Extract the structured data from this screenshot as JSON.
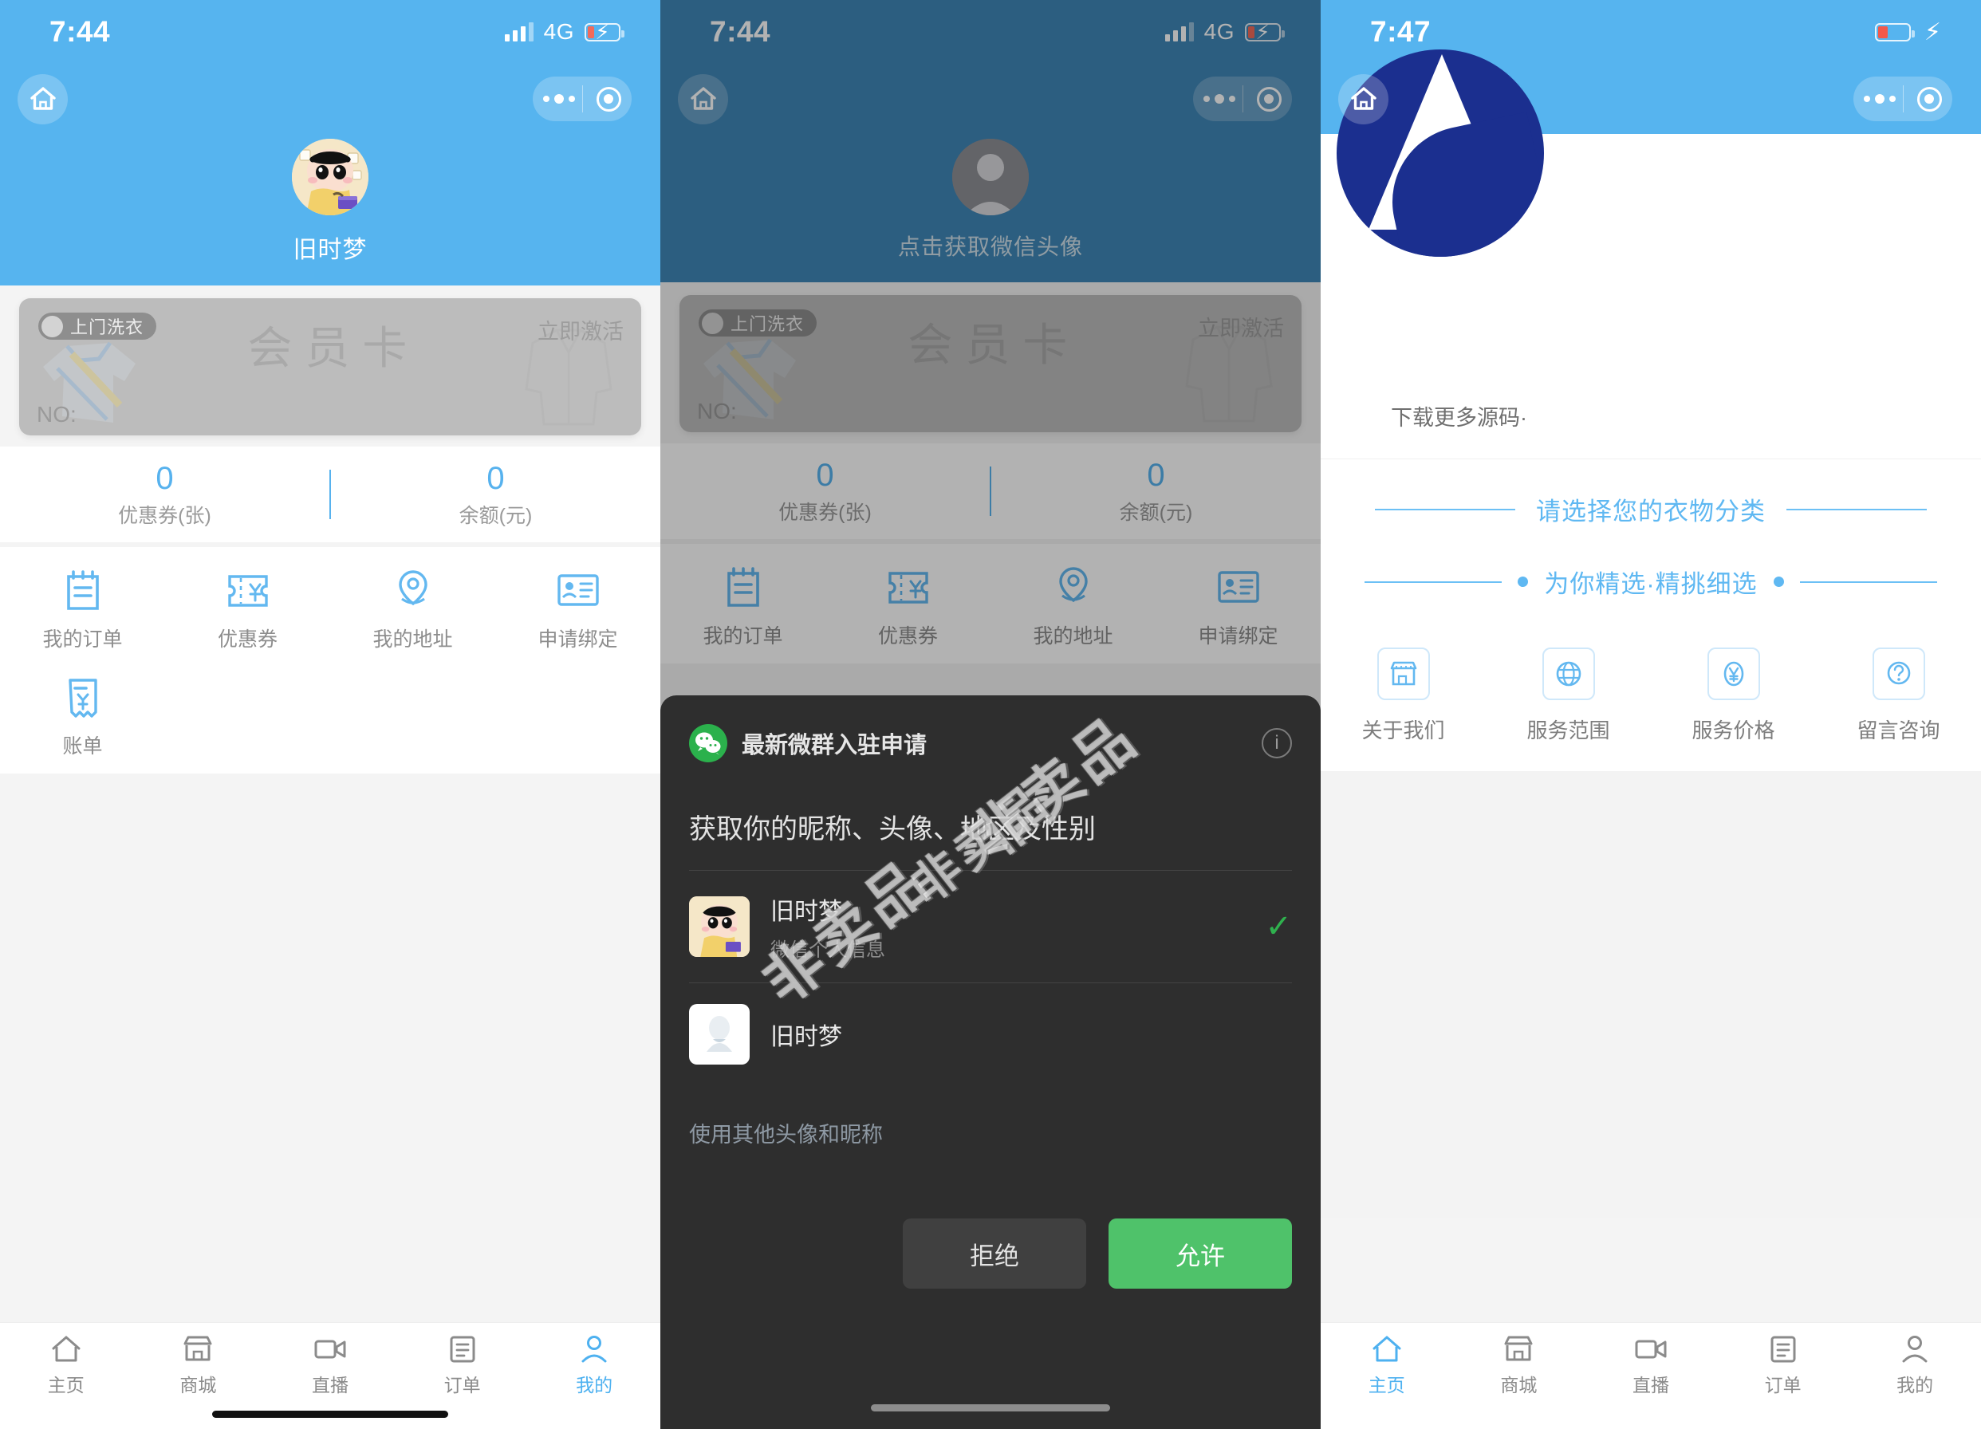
{
  "panels": [
    {
      "status": {
        "time": "7:44",
        "network": "4G",
        "battery_state": "charging"
      },
      "nav": {
        "home_icon": "home-icon",
        "more_icon": "more-dots-icon",
        "target_icon": "target-icon"
      },
      "profile": {
        "nickname": "旧时梦",
        "avatar_alt": "crayon-shinchan-avatar"
      },
      "member_card": {
        "badge": "上门洗衣",
        "title": "会员卡",
        "activate": "立即激活",
        "number_label": "NO:"
      },
      "stats": [
        {
          "value": "0",
          "label": "优惠券(张)"
        },
        {
          "value": "0",
          "label": "余额(元)"
        }
      ],
      "menu": [
        {
          "label": "我的订单",
          "icon": "order-list-icon"
        },
        {
          "label": "优惠券",
          "icon": "coupon-icon"
        },
        {
          "label": "我的地址",
          "icon": "location-pin-icon"
        },
        {
          "label": "申请绑定",
          "icon": "id-card-icon"
        },
        {
          "label": "账单",
          "icon": "receipt-icon"
        }
      ],
      "tabbar": [
        {
          "label": "主页",
          "icon": "home-icon",
          "active": false
        },
        {
          "label": "商城",
          "icon": "shop-icon",
          "active": false
        },
        {
          "label": "直播",
          "icon": "video-icon",
          "active": false
        },
        {
          "label": "订单",
          "icon": "list-icon",
          "active": false
        },
        {
          "label": "我的",
          "icon": "user-icon",
          "active": true
        }
      ]
    },
    {
      "status": {
        "time": "7:44",
        "network": "4G",
        "battery_state": "charging"
      },
      "profile": {
        "nickname": "点击获取微信头像",
        "avatar_alt": "default-grey-avatar"
      },
      "modal": {
        "app_name": "最新微群入驻申请",
        "info_icon": "info-icon",
        "scope": "获取你的昵称、头像、地区及性别",
        "accounts": [
          {
            "name": "旧时梦",
            "sub": "微信个人信息",
            "selected": true,
            "avatar_alt": "crayon-shinchan-avatar"
          },
          {
            "name": "旧时梦",
            "sub": "",
            "selected": false,
            "avatar_alt": "white-photo-avatar"
          }
        ],
        "other_link": "使用其他头像和昵称",
        "reject": "拒绝",
        "allow": "允许"
      },
      "watermarks": [
        "非卖品",
        "非卖品",
        "非卖品",
        "非卖品"
      ]
    },
    {
      "status": {
        "time": "7:47",
        "network": "",
        "battery_state": "low-charging"
      },
      "source_note": "下载更多源码·",
      "section1": "请选择您的衣物分类",
      "section2": "为你精选·精挑细选",
      "services": [
        {
          "label": "关于我们",
          "icon": "store-icon"
        },
        {
          "label": "服务范围",
          "icon": "globe-icon"
        },
        {
          "label": "服务价格",
          "icon": "yuan-price-icon"
        },
        {
          "label": "留言咨询",
          "icon": "question-chat-icon"
        }
      ],
      "tabbar": [
        {
          "label": "主页",
          "icon": "home-icon",
          "active": true
        },
        {
          "label": "商城",
          "icon": "shop-icon",
          "active": false
        },
        {
          "label": "直播",
          "icon": "video-icon",
          "active": false
        },
        {
          "label": "订单",
          "icon": "list-icon",
          "active": false
        },
        {
          "label": "我的",
          "icon": "user-icon",
          "active": false
        }
      ]
    }
  ],
  "colors": {
    "brand_blue": "#56b4ef",
    "accent_blue": "#57b2ee",
    "wechat_green": "#4fc26a",
    "card_grey": "#bcbcbc",
    "modal_bg": "#2e2e2e"
  }
}
